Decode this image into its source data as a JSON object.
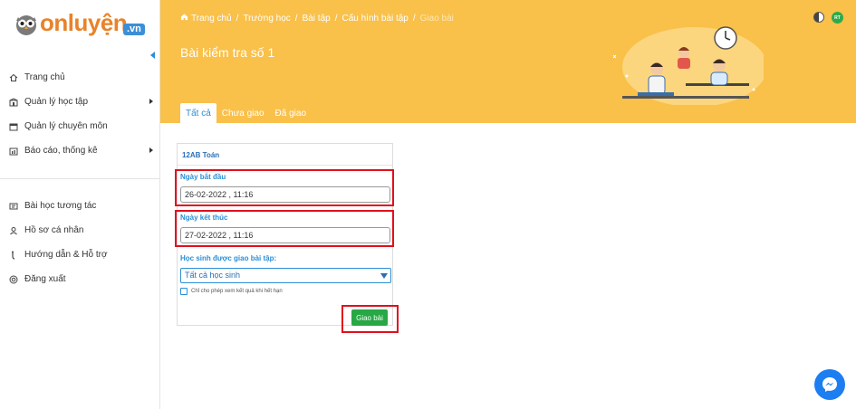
{
  "brand": {
    "logo_text": "onluyện",
    "logo_domain": ".vn"
  },
  "sidebar": {
    "menu_top": [
      {
        "label": "Trang chủ",
        "icon": "home-icon",
        "has_submenu": false
      },
      {
        "label": "Quản lý học tập",
        "icon": "school-icon",
        "has_submenu": true
      },
      {
        "label": "Quản lý chuyên môn",
        "icon": "calendar-icon",
        "has_submenu": false
      },
      {
        "label": "Báo cáo, thống kê",
        "icon": "report-icon",
        "has_submenu": true
      }
    ],
    "menu_bottom": [
      {
        "label": "Bài học tương tác",
        "icon": "lesson-icon"
      },
      {
        "label": "Hồ sơ cá nhân",
        "icon": "user-icon"
      },
      {
        "label": "Hướng dẫn & Hỗ trợ",
        "icon": "help-icon"
      },
      {
        "label": "Đăng xuất",
        "icon": "logout-icon"
      }
    ]
  },
  "header": {
    "breadcrumb": [
      "Trang chủ",
      "Trường học",
      "Bài tập",
      "Cấu hình bài tập",
      "Giao bài"
    ],
    "title": "Bài kiểm tra số 1",
    "avatar_initials": "RT",
    "tabs": [
      {
        "label": "Tất cả",
        "active": true
      },
      {
        "label": "Chưa giao",
        "active": false
      },
      {
        "label": "Đã giao",
        "active": false
      }
    ]
  },
  "form": {
    "class_name": "12AB Toán",
    "start_label": "Ngày bắt đầu",
    "start_value": "26-02-2022 , 11:16",
    "end_label": "Ngày kết thúc",
    "end_value": "27-02-2022 , 11:16",
    "students_label": "Học sinh được giao bài tập:",
    "students_selected": "Tất cả học sinh",
    "checkbox_label": "Chỉ cho phép xem kết quả khi hết hạn",
    "checkbox_checked": false,
    "submit_label": "Giao bài"
  },
  "colors": {
    "header_bg": "#f9c04a",
    "accent": "#2a8fd6",
    "button_green": "#28a745",
    "highlight_red": "#e0101d"
  }
}
